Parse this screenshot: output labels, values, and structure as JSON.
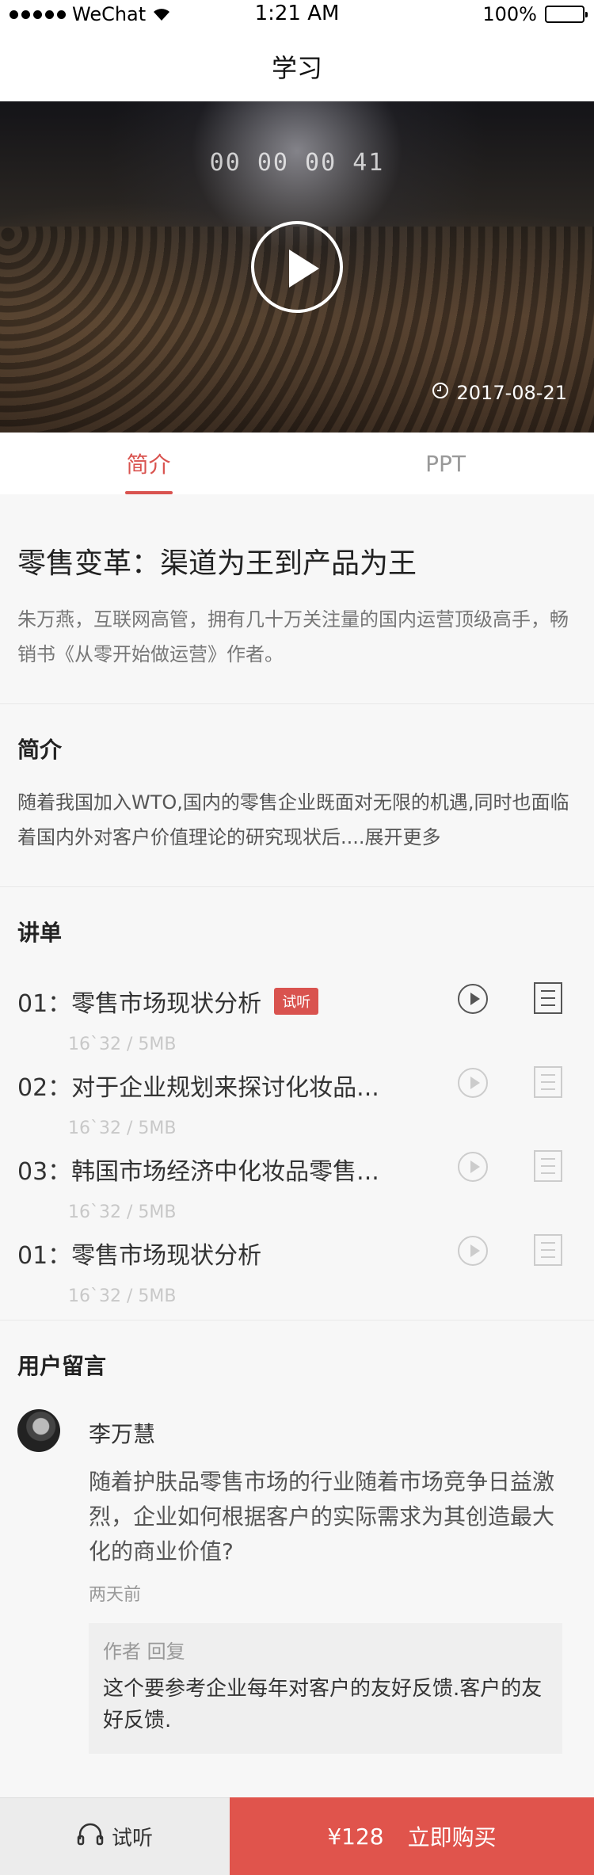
{
  "status": {
    "carrier": "WeChat",
    "time": "1:21 AM",
    "battery": "100%"
  },
  "nav": {
    "title": "学习"
  },
  "video": {
    "screen_text": "00 00 00 41",
    "date": "2017-08-21"
  },
  "tabs": [
    {
      "label": "简介"
    },
    {
      "label": "PPT"
    }
  ],
  "course": {
    "title": "零售变革：渠道为王到产品为王",
    "description": "朱万燕，互联网高管，拥有几十万关注量的国内运营顶级高手，畅销书《从零开始做运营》作者。"
  },
  "intro": {
    "title": "简介",
    "text": "随着我国加入WTO,国内的零售企业既面对无限的机遇,同时也面临着国内外对客户价值理论的研究现状后....",
    "more": "展开更多"
  },
  "lessons": {
    "title": "讲单",
    "items": [
      {
        "title": "01：零售市场现状分析",
        "tag": "试听",
        "meta": "16`32 / 5MB"
      },
      {
        "title": "02：对于企业规划来探讨化妆品...",
        "tag": "",
        "meta": "16`32 / 5MB"
      },
      {
        "title": "03：韩国市场经济中化妆品零售...",
        "tag": "",
        "meta": "16`32 / 5MB"
      },
      {
        "title": "01：零售市场现状分析",
        "tag": "",
        "meta": "16`32 / 5MB"
      }
    ]
  },
  "comments": {
    "title": "用户留言",
    "items": [
      {
        "name": "李万慧",
        "text": "随着护肤品零售市场的行业随着市场竞争日益激烈，企业如何根据客户的实际需求为其创造最大化的商业价值?",
        "time": "两天前",
        "reply_title": "作者 回复",
        "reply_text": "这个要参考企业每年对客户的友好反馈.客户的友好反馈."
      }
    ]
  },
  "bottom": {
    "trial_label": "试听",
    "price": "¥128",
    "buy_label": "立即购买"
  },
  "colors": {
    "accent": "#d9534f"
  }
}
